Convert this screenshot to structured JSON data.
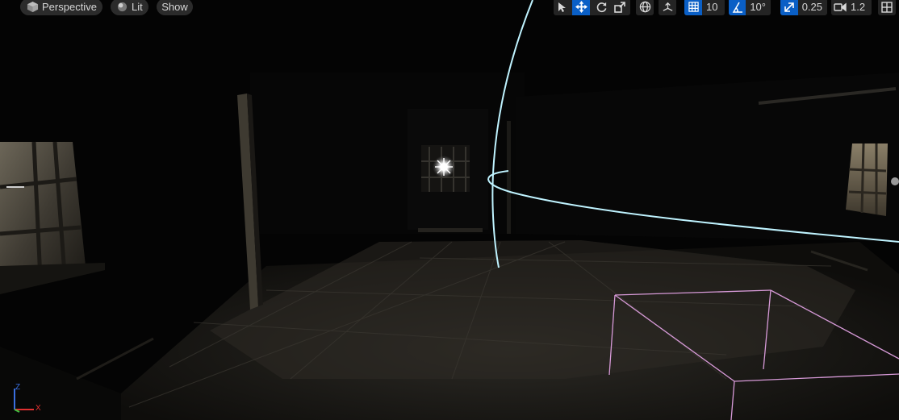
{
  "toolbar": {
    "view_mode": "Perspective",
    "lighting_mode": "Lit",
    "show_label": "Show",
    "grid_snap_value": "10",
    "rotation_snap_value": "10°",
    "scale_snap_value": "0.25",
    "camera_speed_value": "1.2"
  },
  "axis_gizmo": {
    "x_label": "X",
    "z_label": "Z"
  },
  "colors": {
    "toolbar_bg": "#2b2b2b",
    "active_blue": "#0a5fc6",
    "sphere_wire": "#bff3ff",
    "box_wire": "#d79ad8",
    "axis_x": "#e03030",
    "axis_y": "#40c040",
    "axis_z": "#3a6fe0"
  }
}
